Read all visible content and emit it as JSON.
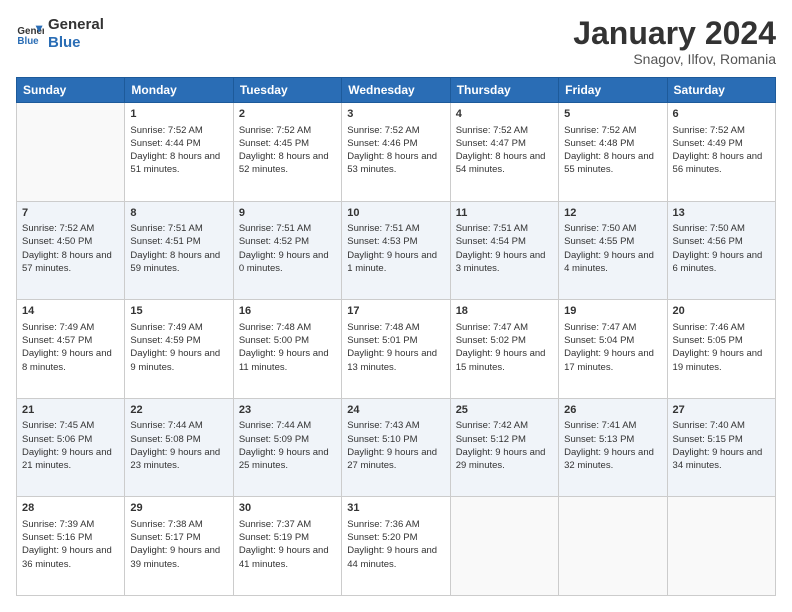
{
  "logo": {
    "line1": "General",
    "line2": "Blue"
  },
  "title": "January 2024",
  "subtitle": "Snagov, Ilfov, Romania",
  "weekdays": [
    "Sunday",
    "Monday",
    "Tuesday",
    "Wednesday",
    "Thursday",
    "Friday",
    "Saturday"
  ],
  "weeks": [
    [
      {
        "day": "",
        "sunrise": "",
        "sunset": "",
        "daylight": ""
      },
      {
        "day": "1",
        "sunrise": "Sunrise: 7:52 AM",
        "sunset": "Sunset: 4:44 PM",
        "daylight": "Daylight: 8 hours and 51 minutes."
      },
      {
        "day": "2",
        "sunrise": "Sunrise: 7:52 AM",
        "sunset": "Sunset: 4:45 PM",
        "daylight": "Daylight: 8 hours and 52 minutes."
      },
      {
        "day": "3",
        "sunrise": "Sunrise: 7:52 AM",
        "sunset": "Sunset: 4:46 PM",
        "daylight": "Daylight: 8 hours and 53 minutes."
      },
      {
        "day": "4",
        "sunrise": "Sunrise: 7:52 AM",
        "sunset": "Sunset: 4:47 PM",
        "daylight": "Daylight: 8 hours and 54 minutes."
      },
      {
        "day": "5",
        "sunrise": "Sunrise: 7:52 AM",
        "sunset": "Sunset: 4:48 PM",
        "daylight": "Daylight: 8 hours and 55 minutes."
      },
      {
        "day": "6",
        "sunrise": "Sunrise: 7:52 AM",
        "sunset": "Sunset: 4:49 PM",
        "daylight": "Daylight: 8 hours and 56 minutes."
      }
    ],
    [
      {
        "day": "7",
        "sunrise": "Sunrise: 7:52 AM",
        "sunset": "Sunset: 4:50 PM",
        "daylight": "Daylight: 8 hours and 57 minutes."
      },
      {
        "day": "8",
        "sunrise": "Sunrise: 7:51 AM",
        "sunset": "Sunset: 4:51 PM",
        "daylight": "Daylight: 8 hours and 59 minutes."
      },
      {
        "day": "9",
        "sunrise": "Sunrise: 7:51 AM",
        "sunset": "Sunset: 4:52 PM",
        "daylight": "Daylight: 9 hours and 0 minutes."
      },
      {
        "day": "10",
        "sunrise": "Sunrise: 7:51 AM",
        "sunset": "Sunset: 4:53 PM",
        "daylight": "Daylight: 9 hours and 1 minute."
      },
      {
        "day": "11",
        "sunrise": "Sunrise: 7:51 AM",
        "sunset": "Sunset: 4:54 PM",
        "daylight": "Daylight: 9 hours and 3 minutes."
      },
      {
        "day": "12",
        "sunrise": "Sunrise: 7:50 AM",
        "sunset": "Sunset: 4:55 PM",
        "daylight": "Daylight: 9 hours and 4 minutes."
      },
      {
        "day": "13",
        "sunrise": "Sunrise: 7:50 AM",
        "sunset": "Sunset: 4:56 PM",
        "daylight": "Daylight: 9 hours and 6 minutes."
      }
    ],
    [
      {
        "day": "14",
        "sunrise": "Sunrise: 7:49 AM",
        "sunset": "Sunset: 4:57 PM",
        "daylight": "Daylight: 9 hours and 8 minutes."
      },
      {
        "day": "15",
        "sunrise": "Sunrise: 7:49 AM",
        "sunset": "Sunset: 4:59 PM",
        "daylight": "Daylight: 9 hours and 9 minutes."
      },
      {
        "day": "16",
        "sunrise": "Sunrise: 7:48 AM",
        "sunset": "Sunset: 5:00 PM",
        "daylight": "Daylight: 9 hours and 11 minutes."
      },
      {
        "day": "17",
        "sunrise": "Sunrise: 7:48 AM",
        "sunset": "Sunset: 5:01 PM",
        "daylight": "Daylight: 9 hours and 13 minutes."
      },
      {
        "day": "18",
        "sunrise": "Sunrise: 7:47 AM",
        "sunset": "Sunset: 5:02 PM",
        "daylight": "Daylight: 9 hours and 15 minutes."
      },
      {
        "day": "19",
        "sunrise": "Sunrise: 7:47 AM",
        "sunset": "Sunset: 5:04 PM",
        "daylight": "Daylight: 9 hours and 17 minutes."
      },
      {
        "day": "20",
        "sunrise": "Sunrise: 7:46 AM",
        "sunset": "Sunset: 5:05 PM",
        "daylight": "Daylight: 9 hours and 19 minutes."
      }
    ],
    [
      {
        "day": "21",
        "sunrise": "Sunrise: 7:45 AM",
        "sunset": "Sunset: 5:06 PM",
        "daylight": "Daylight: 9 hours and 21 minutes."
      },
      {
        "day": "22",
        "sunrise": "Sunrise: 7:44 AM",
        "sunset": "Sunset: 5:08 PM",
        "daylight": "Daylight: 9 hours and 23 minutes."
      },
      {
        "day": "23",
        "sunrise": "Sunrise: 7:44 AM",
        "sunset": "Sunset: 5:09 PM",
        "daylight": "Daylight: 9 hours and 25 minutes."
      },
      {
        "day": "24",
        "sunrise": "Sunrise: 7:43 AM",
        "sunset": "Sunset: 5:10 PM",
        "daylight": "Daylight: 9 hours and 27 minutes."
      },
      {
        "day": "25",
        "sunrise": "Sunrise: 7:42 AM",
        "sunset": "Sunset: 5:12 PM",
        "daylight": "Daylight: 9 hours and 29 minutes."
      },
      {
        "day": "26",
        "sunrise": "Sunrise: 7:41 AM",
        "sunset": "Sunset: 5:13 PM",
        "daylight": "Daylight: 9 hours and 32 minutes."
      },
      {
        "day": "27",
        "sunrise": "Sunrise: 7:40 AM",
        "sunset": "Sunset: 5:15 PM",
        "daylight": "Daylight: 9 hours and 34 minutes."
      }
    ],
    [
      {
        "day": "28",
        "sunrise": "Sunrise: 7:39 AM",
        "sunset": "Sunset: 5:16 PM",
        "daylight": "Daylight: 9 hours and 36 minutes."
      },
      {
        "day": "29",
        "sunrise": "Sunrise: 7:38 AM",
        "sunset": "Sunset: 5:17 PM",
        "daylight": "Daylight: 9 hours and 39 minutes."
      },
      {
        "day": "30",
        "sunrise": "Sunrise: 7:37 AM",
        "sunset": "Sunset: 5:19 PM",
        "daylight": "Daylight: 9 hours and 41 minutes."
      },
      {
        "day": "31",
        "sunrise": "Sunrise: 7:36 AM",
        "sunset": "Sunset: 5:20 PM",
        "daylight": "Daylight: 9 hours and 44 minutes."
      },
      {
        "day": "",
        "sunrise": "",
        "sunset": "",
        "daylight": ""
      },
      {
        "day": "",
        "sunrise": "",
        "sunset": "",
        "daylight": ""
      },
      {
        "day": "",
        "sunrise": "",
        "sunset": "",
        "daylight": ""
      }
    ]
  ]
}
